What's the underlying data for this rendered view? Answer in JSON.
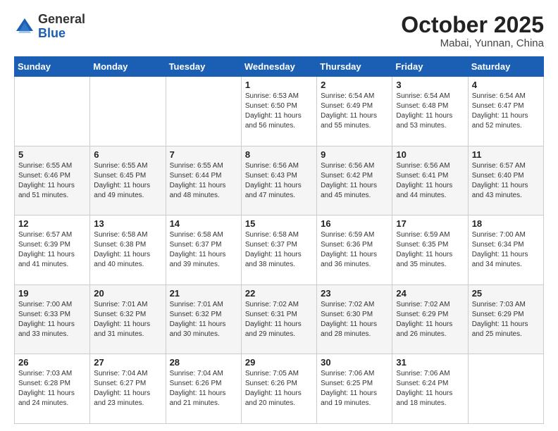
{
  "header": {
    "logo_general": "General",
    "logo_blue": "Blue",
    "month": "October 2025",
    "location": "Mabai, Yunnan, China"
  },
  "weekdays": [
    "Sunday",
    "Monday",
    "Tuesday",
    "Wednesday",
    "Thursday",
    "Friday",
    "Saturday"
  ],
  "weeks": [
    [
      {
        "day": "",
        "info": ""
      },
      {
        "day": "",
        "info": ""
      },
      {
        "day": "",
        "info": ""
      },
      {
        "day": "1",
        "info": "Sunrise: 6:53 AM\nSunset: 6:50 PM\nDaylight: 11 hours and 56 minutes."
      },
      {
        "day": "2",
        "info": "Sunrise: 6:54 AM\nSunset: 6:49 PM\nDaylight: 11 hours and 55 minutes."
      },
      {
        "day": "3",
        "info": "Sunrise: 6:54 AM\nSunset: 6:48 PM\nDaylight: 11 hours and 53 minutes."
      },
      {
        "day": "4",
        "info": "Sunrise: 6:54 AM\nSunset: 6:47 PM\nDaylight: 11 hours and 52 minutes."
      }
    ],
    [
      {
        "day": "5",
        "info": "Sunrise: 6:55 AM\nSunset: 6:46 PM\nDaylight: 11 hours and 51 minutes."
      },
      {
        "day": "6",
        "info": "Sunrise: 6:55 AM\nSunset: 6:45 PM\nDaylight: 11 hours and 49 minutes."
      },
      {
        "day": "7",
        "info": "Sunrise: 6:55 AM\nSunset: 6:44 PM\nDaylight: 11 hours and 48 minutes."
      },
      {
        "day": "8",
        "info": "Sunrise: 6:56 AM\nSunset: 6:43 PM\nDaylight: 11 hours and 47 minutes."
      },
      {
        "day": "9",
        "info": "Sunrise: 6:56 AM\nSunset: 6:42 PM\nDaylight: 11 hours and 45 minutes."
      },
      {
        "day": "10",
        "info": "Sunrise: 6:56 AM\nSunset: 6:41 PM\nDaylight: 11 hours and 44 minutes."
      },
      {
        "day": "11",
        "info": "Sunrise: 6:57 AM\nSunset: 6:40 PM\nDaylight: 11 hours and 43 minutes."
      }
    ],
    [
      {
        "day": "12",
        "info": "Sunrise: 6:57 AM\nSunset: 6:39 PM\nDaylight: 11 hours and 41 minutes."
      },
      {
        "day": "13",
        "info": "Sunrise: 6:58 AM\nSunset: 6:38 PM\nDaylight: 11 hours and 40 minutes."
      },
      {
        "day": "14",
        "info": "Sunrise: 6:58 AM\nSunset: 6:37 PM\nDaylight: 11 hours and 39 minutes."
      },
      {
        "day": "15",
        "info": "Sunrise: 6:58 AM\nSunset: 6:37 PM\nDaylight: 11 hours and 38 minutes."
      },
      {
        "day": "16",
        "info": "Sunrise: 6:59 AM\nSunset: 6:36 PM\nDaylight: 11 hours and 36 minutes."
      },
      {
        "day": "17",
        "info": "Sunrise: 6:59 AM\nSunset: 6:35 PM\nDaylight: 11 hours and 35 minutes."
      },
      {
        "day": "18",
        "info": "Sunrise: 7:00 AM\nSunset: 6:34 PM\nDaylight: 11 hours and 34 minutes."
      }
    ],
    [
      {
        "day": "19",
        "info": "Sunrise: 7:00 AM\nSunset: 6:33 PM\nDaylight: 11 hours and 33 minutes."
      },
      {
        "day": "20",
        "info": "Sunrise: 7:01 AM\nSunset: 6:32 PM\nDaylight: 11 hours and 31 minutes."
      },
      {
        "day": "21",
        "info": "Sunrise: 7:01 AM\nSunset: 6:32 PM\nDaylight: 11 hours and 30 minutes."
      },
      {
        "day": "22",
        "info": "Sunrise: 7:02 AM\nSunset: 6:31 PM\nDaylight: 11 hours and 29 minutes."
      },
      {
        "day": "23",
        "info": "Sunrise: 7:02 AM\nSunset: 6:30 PM\nDaylight: 11 hours and 28 minutes."
      },
      {
        "day": "24",
        "info": "Sunrise: 7:02 AM\nSunset: 6:29 PM\nDaylight: 11 hours and 26 minutes."
      },
      {
        "day": "25",
        "info": "Sunrise: 7:03 AM\nSunset: 6:29 PM\nDaylight: 11 hours and 25 minutes."
      }
    ],
    [
      {
        "day": "26",
        "info": "Sunrise: 7:03 AM\nSunset: 6:28 PM\nDaylight: 11 hours and 24 minutes."
      },
      {
        "day": "27",
        "info": "Sunrise: 7:04 AM\nSunset: 6:27 PM\nDaylight: 11 hours and 23 minutes."
      },
      {
        "day": "28",
        "info": "Sunrise: 7:04 AM\nSunset: 6:26 PM\nDaylight: 11 hours and 21 minutes."
      },
      {
        "day": "29",
        "info": "Sunrise: 7:05 AM\nSunset: 6:26 PM\nDaylight: 11 hours and 20 minutes."
      },
      {
        "day": "30",
        "info": "Sunrise: 7:06 AM\nSunset: 6:25 PM\nDaylight: 11 hours and 19 minutes."
      },
      {
        "day": "31",
        "info": "Sunrise: 7:06 AM\nSunset: 6:24 PM\nDaylight: 11 hours and 18 minutes."
      },
      {
        "day": "",
        "info": ""
      }
    ]
  ]
}
